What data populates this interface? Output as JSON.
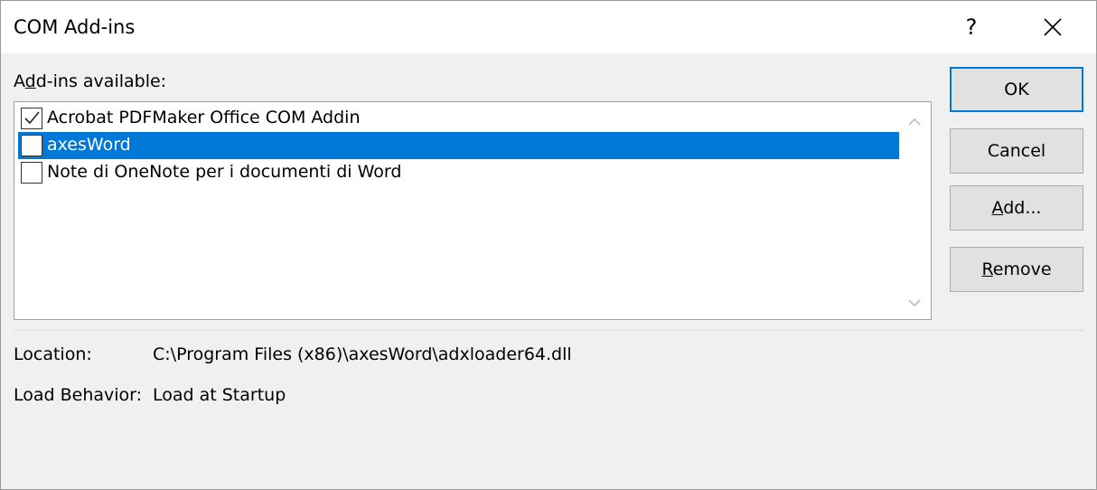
{
  "window": {
    "title": "COM Add-ins",
    "help_label": "?",
    "close_icon": "close-icon"
  },
  "addins": {
    "label_pre": "A",
    "label_accel": "d",
    "label_post": "d-ins available:",
    "items": [
      {
        "label": "Acrobat PDFMaker Office COM Addin",
        "checked": true,
        "selected": false
      },
      {
        "label": "axesWord",
        "checked": false,
        "selected": true
      },
      {
        "label": "Note di OneNote per i documenti di Word",
        "checked": false,
        "selected": false
      }
    ]
  },
  "buttons": {
    "ok": "OK",
    "cancel": "Cancel",
    "add_accel": "A",
    "add_rest": "dd...",
    "remove_accel": "R",
    "remove_rest": "emove"
  },
  "details": {
    "location_label": "Location:",
    "location_value": "C:\\Program Files (x86)\\axesWord\\adxloader64.dll",
    "load_behavior_label": "Load Behavior:",
    "load_behavior_value": "Load at Startup"
  },
  "colors": {
    "selection": "#0078d7",
    "dialog_bg": "#f0f0f0",
    "button_bg": "#e1e1e1"
  }
}
